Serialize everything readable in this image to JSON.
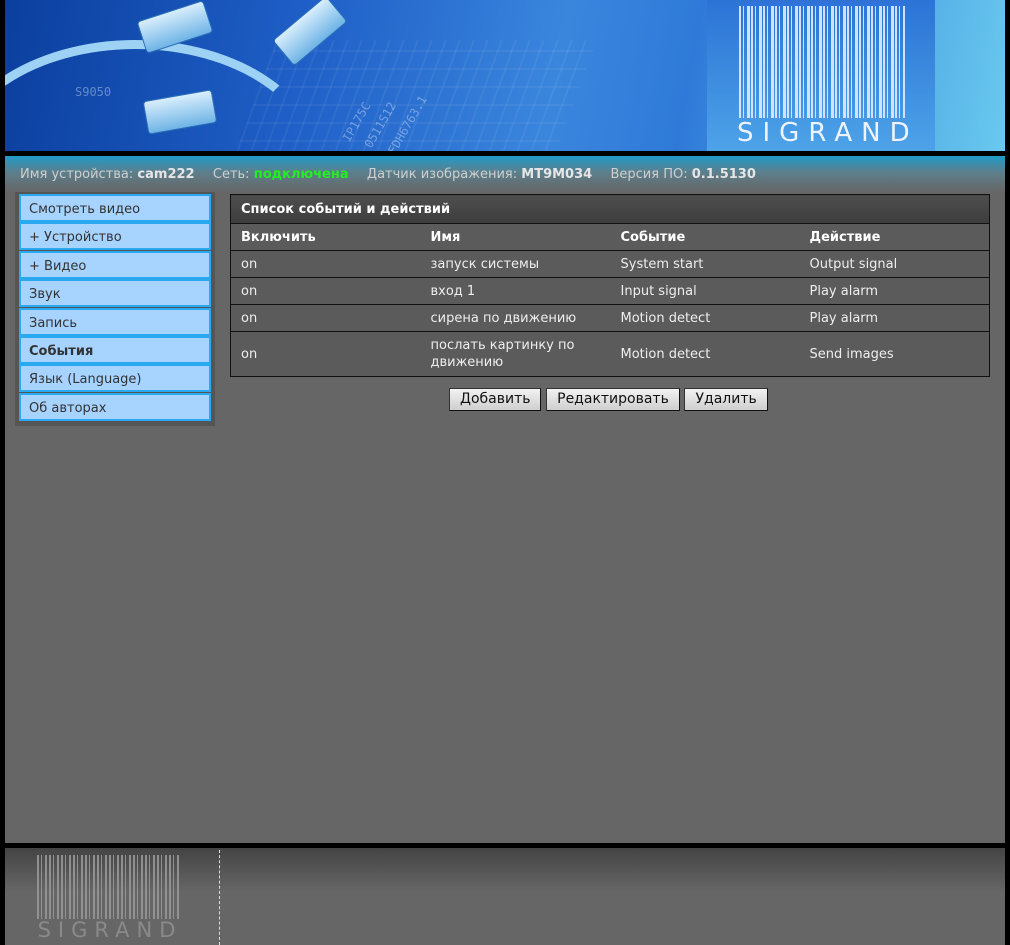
{
  "header": {
    "logo_text": "SIGRAND",
    "chip_markings": [
      "IP175C",
      "0511S12",
      "FDH6763.1"
    ],
    "deco_numbers": [
      "S9050"
    ]
  },
  "status": {
    "device_name_label": "Имя устройства:",
    "device_name_value": "cam222",
    "network_label": "Сеть:",
    "network_value": "подключена",
    "sensor_label": "Датчик изображения:",
    "sensor_value": "MT9M034",
    "firmware_label": "Версия ПО:",
    "firmware_value": "0.1.5130",
    "network_color": "#22ee22"
  },
  "sidebar": {
    "items": [
      {
        "label": "Смотреть видео",
        "active": false
      },
      {
        "label": "+ Устройство",
        "active": false
      },
      {
        "label": "+ Видео",
        "active": false
      },
      {
        "label": "Звук",
        "active": false
      },
      {
        "label": "Запись",
        "active": false
      },
      {
        "label": "События",
        "active": true
      },
      {
        "label": "Язык (Language)",
        "active": false
      },
      {
        "label": "Об авторах",
        "active": false
      }
    ]
  },
  "events": {
    "title": "Список событий и действий",
    "columns": [
      "Включить",
      "Имя",
      "Событие",
      "Действие"
    ],
    "rows": [
      {
        "enabled": "on",
        "name": "запуск системы",
        "event": "System start",
        "action": "Output signal"
      },
      {
        "enabled": "on",
        "name": "вход 1",
        "event": "Input signal",
        "action": "Play alarm"
      },
      {
        "enabled": "on",
        "name": "сирена по движению",
        "event": "Motion detect",
        "action": "Play alarm"
      },
      {
        "enabled": "on",
        "name": "послать картинку по движению",
        "event": "Motion detect",
        "action": "Send images"
      }
    ]
  },
  "buttons": {
    "add": "Добавить",
    "edit": "Редактировать",
    "delete": "Удалить"
  },
  "footer": {
    "logo_text": "SIGRAND"
  }
}
